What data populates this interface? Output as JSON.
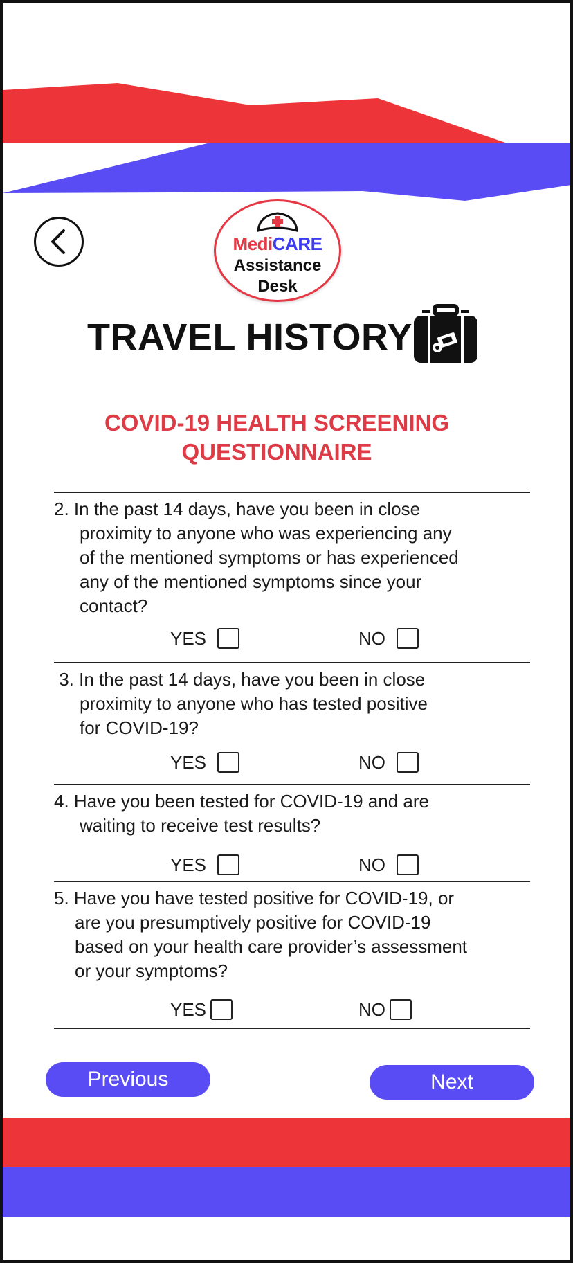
{
  "colors": {
    "red_accent": "#ed3539",
    "blue_accent": "#5a4cf5",
    "subtitle_red": "#dd3b45",
    "brand_blue": "#3c3cf0"
  },
  "header": {
    "back_icon": "chevron-left-icon",
    "logo": {
      "brand_part1": "Medi",
      "brand_part2": "CARE",
      "line1": "Assistance",
      "line2": "Desk",
      "icon": "nurse-cap-icon"
    },
    "title": "TRAVEL HISTORY",
    "title_icon": "suitcase-icon",
    "subtitle": "COVID-19 HEALTH  SCREENING\nQUESTIONNAIRE"
  },
  "questions": [
    {
      "lines": [
        "2. In the past 14 days, have you been in close",
        "proximity to anyone who was experiencing  any",
        "of the mentioned symptoms or has experienced",
        "any of the mentioned symptoms  since your",
        "contact?"
      ],
      "yes_label": "YES",
      "no_label": "NO"
    },
    {
      "lines": [
        " 3. In the past 14 days, have you been in close",
        "proximity to anyone who has tested positive",
        "for COVID-19?"
      ],
      "yes_label": "YES",
      "no_label": "NO"
    },
    {
      "lines": [
        "4. Have you been tested for COVID-19 and are",
        "waiting to receive test results?"
      ],
      "yes_label": "YES",
      "no_label": "NO"
    },
    {
      "lines": [
        "5. Have you have tested positive for COVID-19, or",
        "are you presumptively positive for COVID-19",
        "based on your health care provider’s assessment",
        "or your symptoms?"
      ],
      "yes_label": "YES",
      "no_label": "NO"
    }
  ],
  "navigation": {
    "previous_label": "Previous",
    "next_label": "Next"
  }
}
